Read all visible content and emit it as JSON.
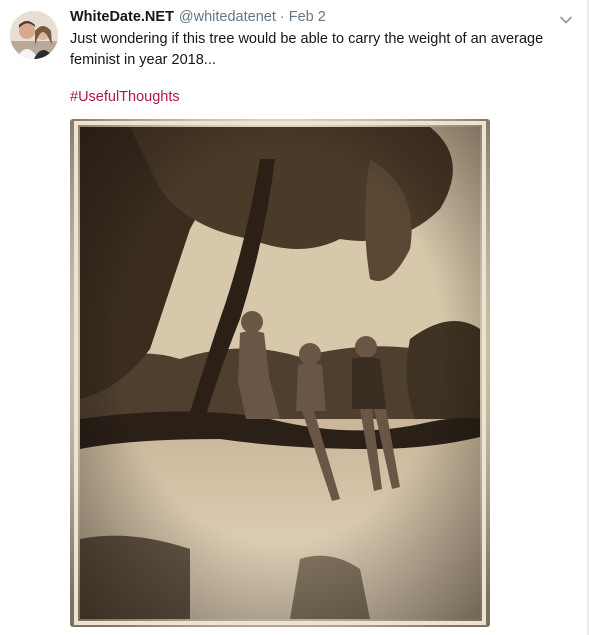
{
  "tweet": {
    "display_name": "WhiteDate.NET",
    "handle": "@whitedatenet",
    "separator": "·",
    "date": "Feb 2",
    "text": "Just wondering if this tree would be able to carry the weight of an average feminist in year 2018...",
    "hashtag": "#UsefulThoughts",
    "menu_icon": "chevron-down-icon"
  },
  "colors": {
    "hashtag": "#b0174e",
    "muted": "#657786",
    "text": "#14171a"
  }
}
